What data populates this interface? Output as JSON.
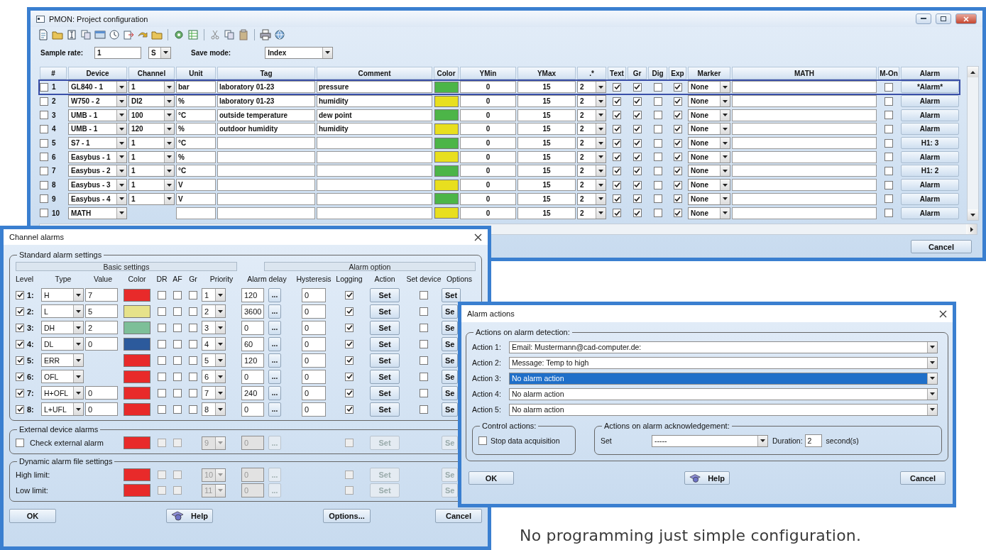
{
  "project_window": {
    "title": "PMON: Project configuration",
    "sample_rate_label": "Sample rate:",
    "sample_rate": "1",
    "sample_unit": "S",
    "save_mode_label": "Save mode:",
    "save_mode": "Index",
    "columns": [
      "#",
      "Device",
      "Channel",
      "Unit",
      "Tag",
      "Comment",
      "Color",
      "YMin",
      "YMax",
      ".*",
      "Text",
      "Gr",
      "Dig",
      "Exp",
      "Marker",
      "MATH",
      "M-On",
      "Alarm"
    ],
    "rows": [
      {
        "selected": true,
        "checked": false,
        "index": "1",
        "device": "GL840 - 1",
        "channel": "1",
        "unit": "bar",
        "tag": "laboratory 01-23",
        "comment": "pressure",
        "color": "#4cb548",
        "ymin": "0",
        "ymax": "15",
        "decimals": "2",
        "text": true,
        "gr": true,
        "dig": false,
        "exp": true,
        "marker": "None",
        "m_on": false,
        "alarm": "*Alarm*"
      },
      {
        "selected": false,
        "checked": false,
        "index": "2",
        "device": "W750 - 2",
        "channel": "DI2",
        "unit": "%",
        "tag": "laboratory 01-23",
        "comment": "humidity",
        "color": "#e8df1f",
        "ymin": "0",
        "ymax": "15",
        "decimals": "2",
        "text": true,
        "gr": true,
        "dig": false,
        "exp": true,
        "marker": "None",
        "m_on": false,
        "alarm": "Alarm"
      },
      {
        "selected": false,
        "checked": false,
        "index": "3",
        "device": "UMB - 1",
        "channel": "100",
        "unit": "°C",
        "tag": "outside temperature",
        "comment": "dew point",
        "color": "#4cb548",
        "ymin": "0",
        "ymax": "15",
        "decimals": "2",
        "text": true,
        "gr": true,
        "dig": false,
        "exp": true,
        "marker": "None",
        "m_on": false,
        "alarm": "Alarm"
      },
      {
        "selected": false,
        "checked": false,
        "index": "4",
        "device": "UMB - 1",
        "channel": "120",
        "unit": "%",
        "tag": "outdoor humidity",
        "comment": "humidity",
        "color": "#e8df1f",
        "ymin": "0",
        "ymax": "15",
        "decimals": "2",
        "text": true,
        "gr": true,
        "dig": false,
        "exp": true,
        "marker": "None",
        "m_on": false,
        "alarm": "Alarm"
      },
      {
        "selected": false,
        "checked": false,
        "index": "5",
        "device": "S7 - 1",
        "channel": "1",
        "unit": "°C",
        "tag": "",
        "comment": "",
        "color": "#4cb548",
        "ymin": "0",
        "ymax": "15",
        "decimals": "2",
        "text": true,
        "gr": true,
        "dig": false,
        "exp": true,
        "marker": "None",
        "m_on": false,
        "alarm": "H1: 3"
      },
      {
        "selected": false,
        "checked": false,
        "index": "6",
        "device": "Easybus - 1",
        "channel": "1",
        "unit": "%",
        "tag": "",
        "comment": "",
        "color": "#e8df1f",
        "ymin": "0",
        "ymax": "15",
        "decimals": "2",
        "text": true,
        "gr": true,
        "dig": false,
        "exp": true,
        "marker": "None",
        "m_on": false,
        "alarm": "Alarm"
      },
      {
        "selected": false,
        "checked": false,
        "index": "7",
        "device": "Easybus - 2",
        "channel": "1",
        "unit": "°C",
        "tag": "",
        "comment": "",
        "color": "#4cb548",
        "ymin": "0",
        "ymax": "15",
        "decimals": "2",
        "text": true,
        "gr": true,
        "dig": false,
        "exp": true,
        "marker": "None",
        "m_on": false,
        "alarm": "H1: 2"
      },
      {
        "selected": false,
        "checked": false,
        "index": "8",
        "device": "Easybus - 3",
        "channel": "1",
        "unit": "V",
        "tag": "",
        "comment": "",
        "color": "#e8df1f",
        "ymin": "0",
        "ymax": "15",
        "decimals": "2",
        "text": true,
        "gr": true,
        "dig": false,
        "exp": true,
        "marker": "None",
        "m_on": false,
        "alarm": "Alarm"
      },
      {
        "selected": false,
        "checked": false,
        "index": "9",
        "device": "Easybus - 4",
        "channel": "1",
        "unit": "V",
        "tag": "",
        "comment": "",
        "color": "#4cb548",
        "ymin": "0",
        "ymax": "15",
        "decimals": "2",
        "text": true,
        "gr": true,
        "dig": false,
        "exp": true,
        "marker": "None",
        "m_on": false,
        "alarm": "Alarm"
      },
      {
        "selected": false,
        "checked": false,
        "index": "10",
        "device": "MATH",
        "unit": "",
        "tag": "",
        "comment": "",
        "color": "#e8df1f",
        "ymin": "0",
        "ymax": "15",
        "decimals": "2",
        "text": true,
        "gr": true,
        "dig": false,
        "exp": true,
        "marker": "None",
        "m_on": false,
        "alarm": "Alarm"
      }
    ],
    "cancel": "Cancel"
  },
  "channel_alarms": {
    "title": "Channel alarms",
    "standard_group": "Standard alarm settings",
    "basic_header": "Basic settings",
    "option_header": "Alarm option",
    "columns": [
      "Level",
      "Type",
      "Value",
      "Color",
      "DR",
      "AF",
      "Gr",
      "Priority",
      "Alarm delay",
      "Hysteresis",
      "Logging",
      "Action",
      "Set device",
      "Options"
    ],
    "levels": [
      {
        "checked": true,
        "label": "1:",
        "type": "H",
        "value": "7",
        "color": "#e82a2a",
        "dr": false,
        "af": false,
        "gr": false,
        "priority": "1",
        "delay": "120",
        "more": "...",
        "hysteresis": "0",
        "logging": true,
        "action": "Set",
        "set_device": false,
        "options": "Set"
      },
      {
        "checked": true,
        "label": "2:",
        "type": "L",
        "value": "5",
        "color": "#e6e28a",
        "dr": false,
        "af": false,
        "gr": false,
        "priority": "2",
        "delay": "3600",
        "more": "...",
        "hysteresis": "0",
        "logging": true,
        "action": "Set",
        "set_device": false,
        "options": "Se"
      },
      {
        "checked": true,
        "label": "3:",
        "type": "DH",
        "value": "2",
        "color": "#7dbf98",
        "dr": false,
        "af": false,
        "gr": false,
        "priority": "3",
        "delay": "0",
        "more": "...",
        "hysteresis": "0",
        "logging": true,
        "action": "Set",
        "set_device": false,
        "options": "Se"
      },
      {
        "checked": true,
        "label": "4:",
        "type": "DL",
        "value": "0",
        "color": "#2c5a9c",
        "dr": false,
        "af": false,
        "gr": false,
        "priority": "4",
        "delay": "60",
        "more": "...",
        "hysteresis": "0",
        "logging": true,
        "action": "Set",
        "set_device": false,
        "options": "Se"
      },
      {
        "checked": true,
        "label": "5:",
        "type": "ERR",
        "color": "#e82a2a",
        "dr": false,
        "af": false,
        "gr": false,
        "priority": "5",
        "delay": "120",
        "more": "...",
        "hysteresis": "0",
        "logging": true,
        "action": "Set",
        "set_device": false,
        "options": "Se"
      },
      {
        "checked": true,
        "label": "6:",
        "type": "OFL",
        "color": "#e82a2a",
        "dr": false,
        "af": false,
        "gr": false,
        "priority": "6",
        "delay": "0",
        "more": "...",
        "hysteresis": "0",
        "logging": true,
        "action": "Set",
        "set_device": false,
        "options": "Se"
      },
      {
        "checked": true,
        "label": "7:",
        "type": "H+OFL",
        "value": "0",
        "color": "#e82a2a",
        "dr": false,
        "af": false,
        "gr": false,
        "priority": "7",
        "delay": "240",
        "more": "...",
        "hysteresis": "0",
        "logging": true,
        "action": "Set",
        "set_device": false,
        "options": "Se"
      },
      {
        "checked": true,
        "label": "8:",
        "type": "L+UFL",
        "value": "0",
        "color": "#e82a2a",
        "dr": false,
        "af": false,
        "gr": false,
        "priority": "8",
        "delay": "0",
        "more": "...",
        "hysteresis": "0",
        "logging": true,
        "action": "Set",
        "set_device": false,
        "options": "Se"
      }
    ],
    "external_group": "External device alarms",
    "external": {
      "label": "Check external alarm",
      "checked": false,
      "color": "#e82a2a",
      "dr": false,
      "af": false,
      "priority": "9",
      "delay": "0",
      "more": "...",
      "logging": false,
      "action": "Set",
      "options": "Se",
      "disabled": true
    },
    "dynamic_group": "Dynamic alarm file settings",
    "dynamic": [
      {
        "label": "High limit:",
        "color": "#e82a2a",
        "dr": false,
        "af": false,
        "priority": "10",
        "delay": "0",
        "more": "...",
        "logging": false,
        "action": "Set",
        "options": "Se",
        "disabled": true
      },
      {
        "label": "Low limit:",
        "color": "#e82a2a",
        "dr": false,
        "af": false,
        "priority": "11",
        "delay": "0",
        "more": "...",
        "logging": false,
        "action": "Set",
        "options": "Se",
        "disabled": true
      }
    ],
    "buttons": {
      "ok": "OK",
      "help": "Help",
      "options": "Options...",
      "cancel": "Cancel"
    }
  },
  "alarm_actions": {
    "title": "Alarm actions",
    "detection_group": "Actions on alarm detection:",
    "actions": [
      {
        "label": "Action 1:",
        "value": "Email: Mustermann@cad-computer.de:",
        "selected": false
      },
      {
        "label": "Action 2:",
        "value": "Message: Temp to high",
        "selected": false
      },
      {
        "label": "Action 3:",
        "value": "No alarm action",
        "selected": true
      },
      {
        "label": "Action 4:",
        "value": "No alarm action",
        "selected": false
      },
      {
        "label": "Action 5:",
        "value": "No alarm action",
        "selected": false
      }
    ],
    "control_group": "Control actions:",
    "stop_label": "Stop data acquisition",
    "stop_checked": false,
    "ack_group": "Actions on alarm acknowledgement:",
    "set_label": "Set",
    "set_value": "-----",
    "duration_label": "Duration:",
    "duration": "2",
    "duration_unit": "second(s)",
    "buttons": {
      "ok": "OK",
      "help": "Help",
      "cancel": "Cancel"
    }
  },
  "caption": "No programming just simple configuration."
}
